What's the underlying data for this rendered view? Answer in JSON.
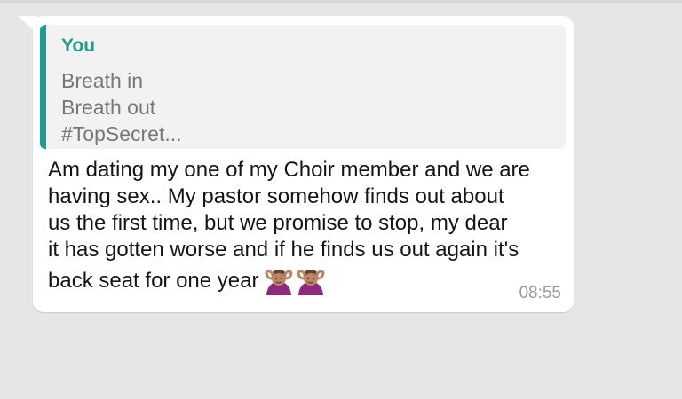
{
  "quoted_message": {
    "author": "You",
    "lines": [
      "Breath in",
      "Breath out",
      "#TopSecret..."
    ]
  },
  "message": {
    "lines": [
      "Am dating my one of my Choir member and we are",
      "having sex.. My pastor somehow finds out about",
      "us the first time, but we promise to stop, my dear",
      "it has gotten worse and if he finds us out again it's",
      "back seat for one year"
    ],
    "emojis": [
      "person-gesturing-ok-icon",
      "person-gesturing-ok-icon"
    ],
    "time": "08:55"
  },
  "colors": {
    "background": "#e6e6e6",
    "bubble": "#ffffff",
    "quote_accent": "#1f9c8b",
    "quote_text": "#777777",
    "timestamp": "#9a9a9a"
  }
}
